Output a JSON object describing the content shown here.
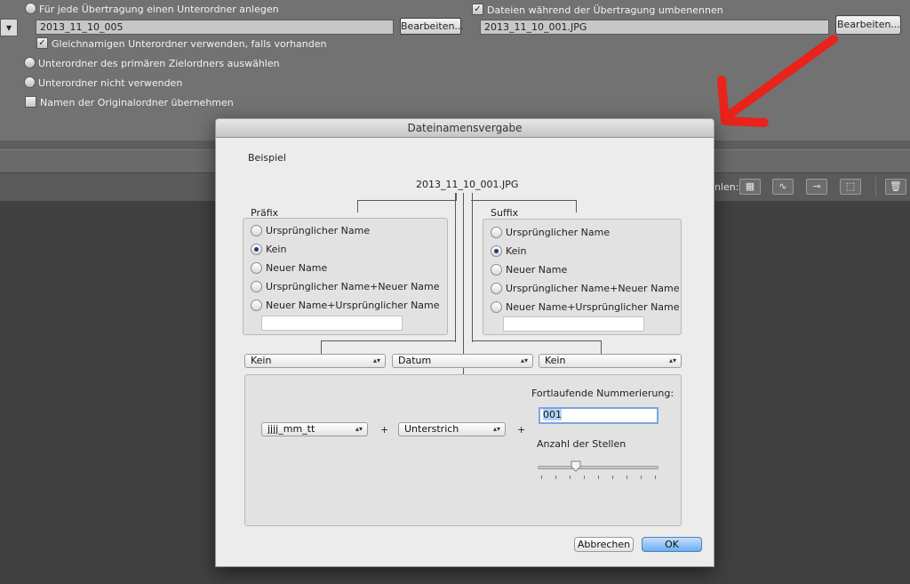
{
  "background": {
    "top_left_dropdown_arrow": "▾",
    "subfolder_option": "Für jede Übertragung einen Unterordner anlegen",
    "subfolder_value": "2013_11_10_005",
    "subfolder_edit_button": "Bearbeiten...",
    "same_name_checkbox": "Gleichnamigen Unterordner verwenden, falls vorhanden",
    "primary_target_option": "Unterordner des primären Zielordners auswählen",
    "no_subfolder_option": "Unterordner nicht verwenden",
    "original_names_checkbox": "Namen der Originalordner übernehmen",
    "rename_checkbox": "Dateien während der Übertragung umbenennen",
    "rename_value": "2013_11_10_001.JPG",
    "rename_edit_button": "Bearbeiten...",
    "toolbar_label_fragment": "nlen:",
    "annotation_arrow_color": "#e8231b"
  },
  "dialog": {
    "title": "Dateinamensvergabe",
    "example_label": "Beispiel",
    "example_filename": "2013_11_10_001.JPG",
    "prefix": {
      "label": "Präfix",
      "options": [
        "Ursprünglicher Name",
        "Kein",
        "Neuer Name",
        "Ursprünglicher Name+Neuer Name",
        "Neuer Name+Ursprünglicher Name"
      ],
      "selected": "Kein",
      "input_value": ""
    },
    "suffix": {
      "label": "Suffix",
      "options": [
        "Ursprünglicher Name",
        "Kein",
        "Neuer Name",
        "Ursprünglicher Name+Neuer Name",
        "Neuer Name+Ursprünglicher Name"
      ],
      "selected": "Kein",
      "input_value": ""
    },
    "popups": {
      "left": "Kein",
      "middle": "Datum",
      "right": "Kein"
    },
    "date_format": "jjjj_mm_tt",
    "plus_sign": "+",
    "separator": "Unterstrich",
    "numbering_label": "Fortlaufende Nummerierung:",
    "numbering_value": "001",
    "digits_label": "Anzahl der Stellen",
    "digits_slider_fraction": 0.3,
    "cancel_button": "Abbrechen",
    "ok_button": "OK"
  }
}
